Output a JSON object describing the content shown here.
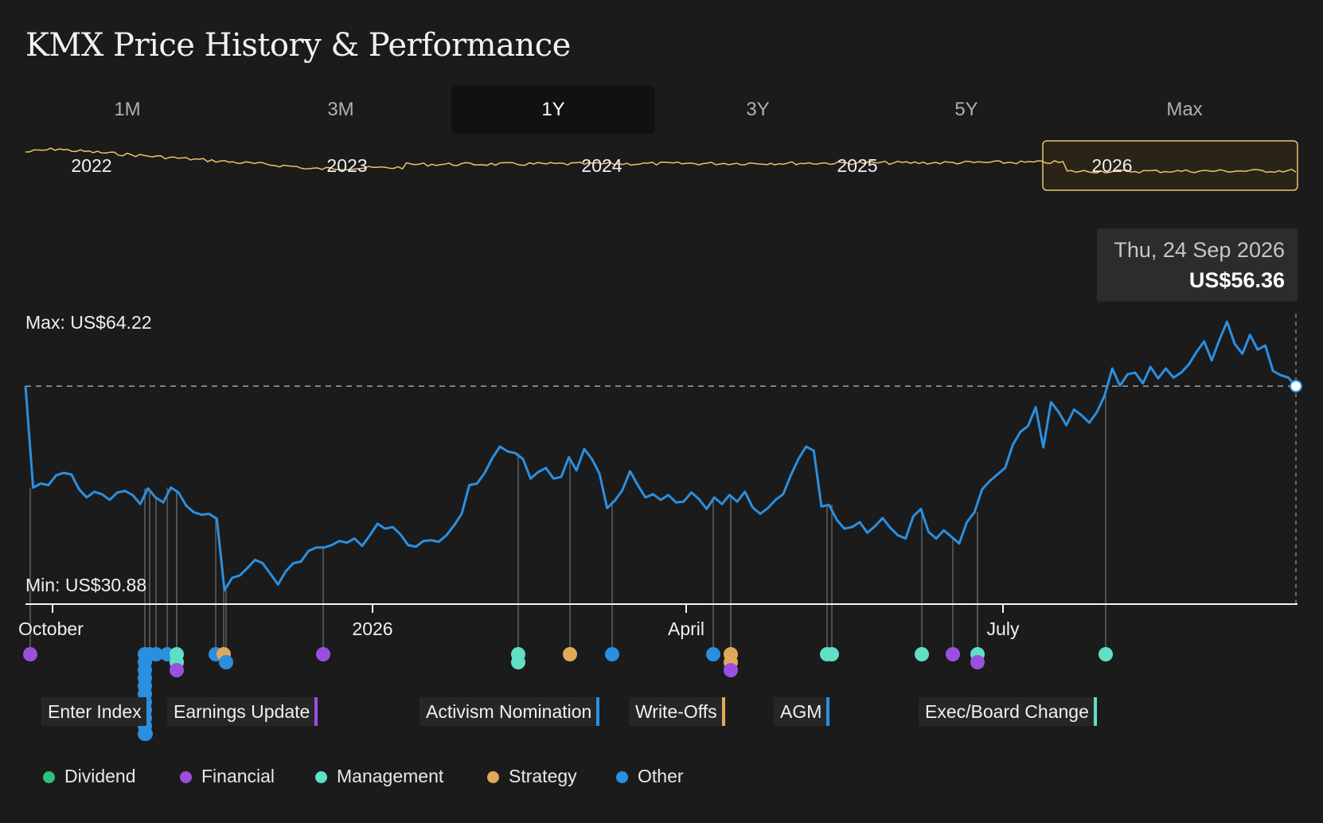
{
  "title": "KMX Price History & Performance",
  "tabs": [
    {
      "label": "1M",
      "active": false
    },
    {
      "label": "3M",
      "active": false
    },
    {
      "label": "1Y",
      "active": true
    },
    {
      "label": "3Y",
      "active": false
    },
    {
      "label": "5Y",
      "active": false
    },
    {
      "label": "Max",
      "active": false
    }
  ],
  "navigator": {
    "year_labels": [
      "2022",
      "2023",
      "2024",
      "2025",
      "2026"
    ],
    "selected_range": "2026",
    "line_color": "#e9c46a"
  },
  "tooltip": {
    "date": "Thu, 24 Sep 2026",
    "price": "US$56.36"
  },
  "stats": {
    "max": "Max: US$64.22",
    "min": "Min: US$30.88"
  },
  "chart_data": {
    "type": "line",
    "x_tick_labels": [
      "October",
      "2026",
      "April",
      "July"
    ],
    "y_range": [
      30.88,
      64.22
    ],
    "reference_line_value": 56.36,
    "line_color": "#2b8fe0",
    "series": [
      {
        "values": [
          56.4,
          44,
          44.5,
          44.3,
          45.5,
          45.8,
          45.6,
          43.8,
          42.8,
          43.5,
          43.2,
          42.5,
          43.4,
          43.6,
          43.1,
          42,
          43.9,
          42.8,
          42.2,
          44,
          43.4,
          41.8,
          41,
          40.7,
          40.8,
          40.2,
          31.5,
          33,
          33.3,
          34.2,
          35.2,
          34.8,
          33.5,
          32.2,
          33.8,
          34.8,
          35,
          36.3,
          36.7,
          36.7,
          37,
          37.5,
          37.3,
          37.8,
          36.9,
          38.2,
          39.6,
          39,
          39.2,
          38.3,
          37,
          36.8,
          37.5,
          37.6,
          37.4,
          38.2,
          39.4,
          40.8,
          44.3,
          44.5,
          45.8,
          47.6,
          49,
          48.4,
          48.2,
          47.5,
          45.1,
          45.9,
          46.4,
          45.1,
          45.3,
          47.7,
          46.1,
          48.7,
          47.5,
          45.7,
          41.5,
          42.4,
          43.7,
          46,
          44.3,
          42.8,
          43.2,
          42.5,
          43.1,
          42.2,
          42.3,
          43.4,
          42.6,
          41.4,
          42.8,
          42,
          43.1,
          42.3,
          43.5,
          41.6,
          40.8,
          41.5,
          42.5,
          43.2,
          45.5,
          47.5,
          49,
          48.5,
          41.7,
          41.9,
          40.1,
          39,
          39.2,
          39.8,
          38.5,
          39.3,
          40.3,
          39.1,
          38.2,
          37.8,
          40.5,
          41.4,
          38.6,
          37.8,
          38.8,
          38,
          37.2,
          39.8,
          41,
          43.8,
          44.8,
          45.6,
          46.4,
          49.2,
          50.8,
          51.5,
          53.8,
          48.9,
          54.4,
          53.2,
          51.6,
          53.5,
          52.8,
          51.9,
          53.2,
          55.2,
          58.5,
          56.4,
          57.8,
          58,
          56.7,
          58.7,
          57.3,
          58.5,
          57.4,
          58,
          59,
          60.5,
          61.8,
          59.5,
          62,
          64.2,
          61.5,
          60.3,
          62.6,
          60.8,
          61.3,
          58.2,
          57.7,
          57.4,
          56.36
        ]
      }
    ]
  },
  "events": [
    {
      "label": "Enter Index",
      "color": "#2b8fe0"
    },
    {
      "label": "Earnings Update",
      "color": "#9b4fe0"
    },
    {
      "label": "Activism Nomination",
      "color": "#2b8fe0"
    },
    {
      "label": "Write-Offs",
      "color": "#e0a95a"
    },
    {
      "label": "AGM",
      "color": "#2b8fe0"
    },
    {
      "label": "Exec/Board Change",
      "color": "#5fe0c4"
    }
  ],
  "legend": [
    {
      "label": "Dividend",
      "color": "#2ec27e"
    },
    {
      "label": "Financial",
      "color": "#9b4fe0"
    },
    {
      "label": "Management",
      "color": "#5fe0c4"
    },
    {
      "label": "Strategy",
      "color": "#e0a95a"
    },
    {
      "label": "Other",
      "color": "#2b8fe0"
    }
  ]
}
